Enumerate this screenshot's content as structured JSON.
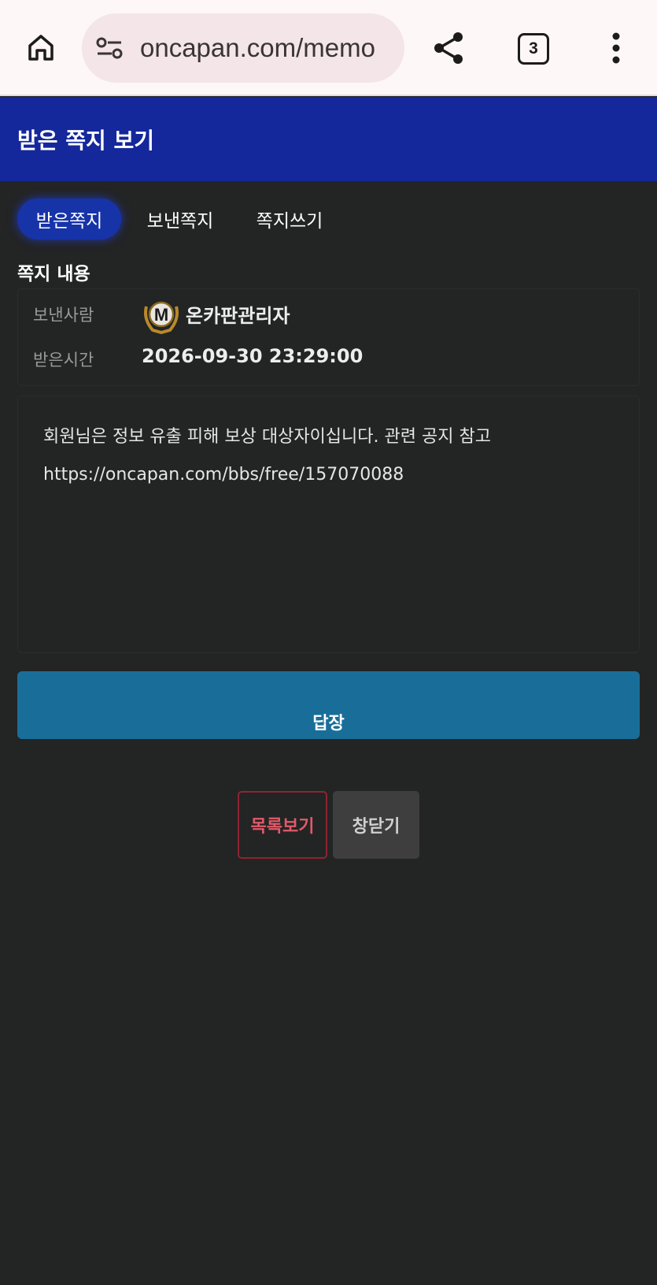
{
  "browser": {
    "url": "oncapan.com/memo",
    "tab_count": "3",
    "icons": [
      "home-icon",
      "site-settings-icon",
      "share-icon",
      "tabs-icon",
      "more-vert-icon"
    ]
  },
  "header": {
    "title": "받은 쪽지 보기"
  },
  "tabs": [
    {
      "label": "받은쪽지",
      "active": true
    },
    {
      "label": "보낸쪽지",
      "active": false
    },
    {
      "label": "쪽지쓰기",
      "active": false
    }
  ],
  "section_title": "쪽지 내용",
  "info": {
    "sender_label": "보낸사람",
    "sender_badge": "M",
    "sender_name": "온카판관리자",
    "received_label": "받은시간",
    "received_time": "2026-09-30 23:29:00"
  },
  "message": {
    "line1": "회원님은 정보 유출 피해 보상 대상자이십니다. 관련 공지 참고",
    "line2": "https://oncapan.com/bbs/free/157070088"
  },
  "buttons": {
    "reply": "답장",
    "list": "목록보기",
    "close": "창닫기"
  },
  "colors": {
    "header_bg": "#14289b",
    "active_tab": "#1733a8",
    "reply_bg": "#196e99",
    "list_border": "#8f2430",
    "page_bg": "#232424"
  }
}
